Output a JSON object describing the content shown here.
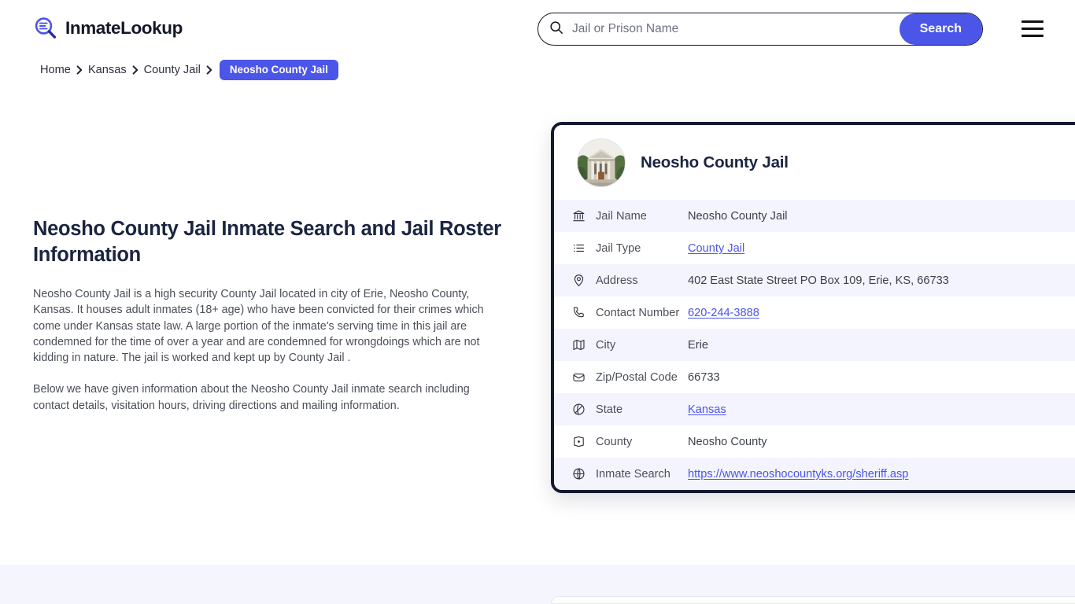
{
  "header": {
    "logo_text": "InmateLookup",
    "logo_icon": "magnifier-list-icon",
    "search": {
      "placeholder": "Jail or Prison Name",
      "value": "",
      "icon": "search-icon",
      "button_label": "Search"
    },
    "menu_icon": "hamburger-menu-icon"
  },
  "breadcrumb": {
    "items": [
      {
        "label": "Home",
        "current": false
      },
      {
        "label": "Kansas",
        "current": false
      },
      {
        "label": "County Jail",
        "current": false
      },
      {
        "label": "Neosho County Jail",
        "current": true
      }
    ],
    "separator": "›"
  },
  "main": {
    "title": "Neosho County Jail Inmate Search and Jail Roster Information",
    "paragraphs": [
      "Neosho County Jail is a high security County Jail located in city of Erie, Neosho County, Kansas. It houses adult inmates (18+ age) who have been convicted for their crimes which come under Kansas state law. A large portion of the inmate's serving time in this jail are condemned for the time of over a year and are condemned for wrongdoings which are not kidding in nature. The jail is worked and kept up by County Jail .",
      "Below we have given information about the Neosho County Jail inmate search including contact details, visitation hours, driving directions and mailing information."
    ]
  },
  "info_card": {
    "photo_alt": "Neosho County Jail courthouse building",
    "title": "Neosho County Jail",
    "rows": [
      {
        "icon": "bank-icon",
        "label": "Jail Name",
        "value": "Neosho County Jail",
        "link": false
      },
      {
        "icon": "list-icon",
        "label": "Jail Type",
        "value": "County Jail",
        "link": true
      },
      {
        "icon": "map-pin-icon",
        "label": "Address",
        "value": "402 East State Street PO Box 109, Erie, KS, 66733",
        "link": false
      },
      {
        "icon": "phone-icon",
        "label": "Contact Number",
        "value": "620-244-3888",
        "link": true
      },
      {
        "icon": "map-icon",
        "label": "City",
        "value": "Erie",
        "link": false
      },
      {
        "icon": "envelope-icon",
        "label": "Zip/Postal Code",
        "value": "66733",
        "link": false
      },
      {
        "icon": "globe-icon",
        "label": "State",
        "value": "Kansas",
        "link": true
      },
      {
        "icon": "map-marker-icon",
        "label": "County",
        "value": "Neosho County",
        "link": false
      },
      {
        "icon": "world-icon",
        "label": "Inmate Search",
        "value": "https://www.neoshocountyks.org/sheriff.asp",
        "link": true
      }
    ]
  },
  "colors": {
    "accent": "#4b55e8",
    "card_border": "#121a2e",
    "row_alt": "#f3f4fd",
    "heading": "#1b2440",
    "body_text": "#4a4f58",
    "band": "#f4f5fd"
  }
}
